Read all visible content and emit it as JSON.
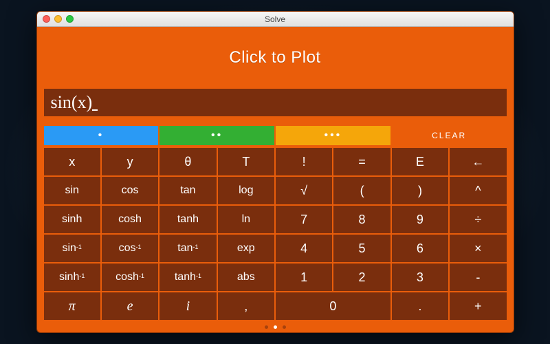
{
  "window": {
    "title": "Solve"
  },
  "plot": {
    "label": "Click to Plot"
  },
  "expression": "sin(x)",
  "groups": {
    "blue_dots": "•",
    "green_dots": "••",
    "yellow_dots": "•••",
    "clear_label": "CLEAR"
  },
  "keys": {
    "r0": [
      "x",
      "y",
      "θ",
      "T",
      "!",
      "=",
      "E",
      "←"
    ],
    "r1": [
      "sin",
      "cos",
      "tan",
      "log",
      "√",
      "(",
      ")",
      "^"
    ],
    "r2": [
      "sinh",
      "cosh",
      "tanh",
      "ln",
      "7",
      "8",
      "9",
      "÷"
    ],
    "r3_inv": [
      "sin",
      "cos",
      "tan"
    ],
    "r3_rest": [
      "exp",
      "4",
      "5",
      "6",
      "×"
    ],
    "r4_inv": [
      "sinh",
      "cosh",
      "tanh"
    ],
    "r4_rest": [
      "abs",
      "1",
      "2",
      "3",
      "-"
    ],
    "r5": [
      "π",
      "e",
      "i",
      ",",
      "0",
      ".",
      "+"
    ]
  },
  "pager": {
    "count": 3,
    "active": 1
  }
}
